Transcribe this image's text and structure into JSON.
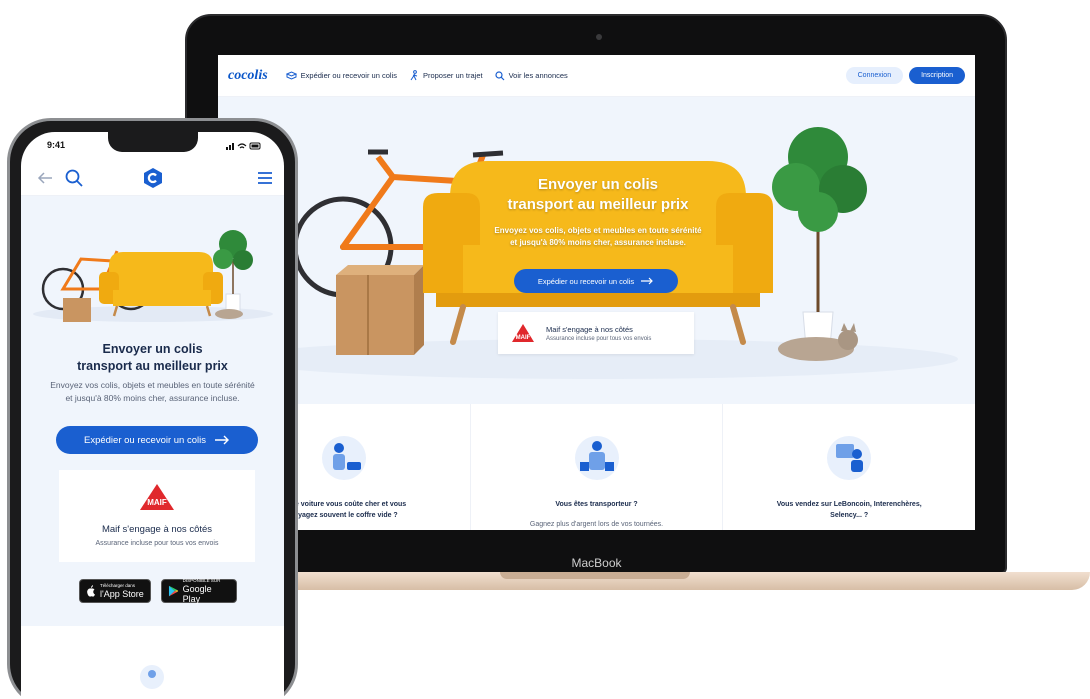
{
  "laptop": {
    "brand_label": "MacBook",
    "nav": {
      "logo": "cocolis",
      "links": [
        "Expédier ou recevoir un colis",
        "Proposer un trajet",
        "Voir les annonces"
      ],
      "login": "Connexion",
      "signup": "Inscription"
    },
    "hero": {
      "title_line1": "Envoyer un colis",
      "title_line2": "transport au meilleur prix",
      "subtitle_line1": "Envoyez vos colis, objets et meubles en toute sérénité",
      "subtitle_line2": "et jusqu'à 80% moins cher, assurance incluse.",
      "cta": "Expédier ou recevoir un colis"
    },
    "insurance": {
      "logo_text": "MAIF",
      "title": "Maif s'engage à nos côtés",
      "subtitle": "Assurance incluse pour tous vos envois"
    },
    "cards": [
      {
        "title_line1": "Votre voiture vous coûte cher et vous",
        "title_line2": "voyagez souvent le coffre vide ?",
        "subtitle": ""
      },
      {
        "title_line1": "Vous êtes transporteur ?",
        "title_line2": "",
        "subtitle": "Gagnez plus d'argent lors de vos tournées."
      },
      {
        "title_line1": "Vous vendez sur LeBoncoin, Interenchères,",
        "title_line2": "Selency... ?",
        "subtitle": ""
      }
    ]
  },
  "phone": {
    "status_time": "9:41",
    "hero": {
      "title_line1": "Envoyer un colis",
      "title_line2": "transport au meilleur prix",
      "subtitle_line1": "Envoyez vos colis, objets et meubles en toute sérénité",
      "subtitle_line2": "et jusqu'à 80% moins cher, assurance incluse.",
      "cta": "Expédier ou recevoir un colis"
    },
    "insurance": {
      "logo_text": "MAIF",
      "title": "Maif s'engage à nos côtés",
      "subtitle": "Assurance incluse pour tous vos envois"
    },
    "stores": {
      "apple_small": "Télécharger dans",
      "apple_big": "l'App Store",
      "google_small": "DISPONIBLE SUR",
      "google_big": "Google Play"
    }
  },
  "colors": {
    "brand_blue": "#1a5fd0",
    "hero_bg": "#f0f5fc",
    "sofa_yellow": "#f6b91b",
    "bike_orange": "#f07a1a",
    "maif_red": "#e0282c"
  }
}
